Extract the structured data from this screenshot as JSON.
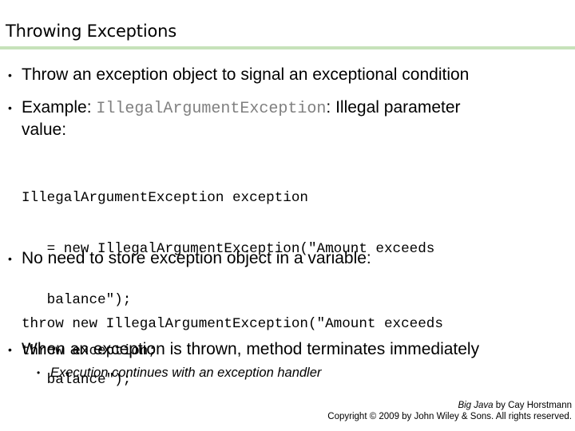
{
  "slide": {
    "title": "Throwing Exceptions",
    "colors": {
      "title_rule": "#c6e2ba",
      "inline_code": "#808080",
      "text": "#000000"
    },
    "bullets": [
      {
        "text": "Throw an exception object to signal an exceptional condition"
      },
      {
        "prefix": "Example: ",
        "code": "IllegalArgumentException",
        "suffix_line1": ": Illegal parameter",
        "suffix_line2": "value:"
      },
      {
        "text": "No need to store exception object in a variable:"
      },
      {
        "text": "When an exception is thrown, method terminates immediately"
      }
    ],
    "code_block_1": [
      "IllegalArgumentException exception",
      "   = new IllegalArgumentException(\"Amount exceeds",
      "   balance\");",
      "throw exception;"
    ],
    "code_block_2": [
      "throw new IllegalArgumentException(\"Amount exceeds",
      "   balance\");"
    ],
    "sub_bullets": [
      {
        "text": "Execution continues with an exception handler"
      }
    ],
    "bullet_glyph": "•",
    "footer": {
      "book_title": "Big Java",
      "book_suffix": " by Cay Horstmann",
      "copyright": "Copyright © 2009 by John Wiley & Sons.  All rights reserved."
    }
  }
}
